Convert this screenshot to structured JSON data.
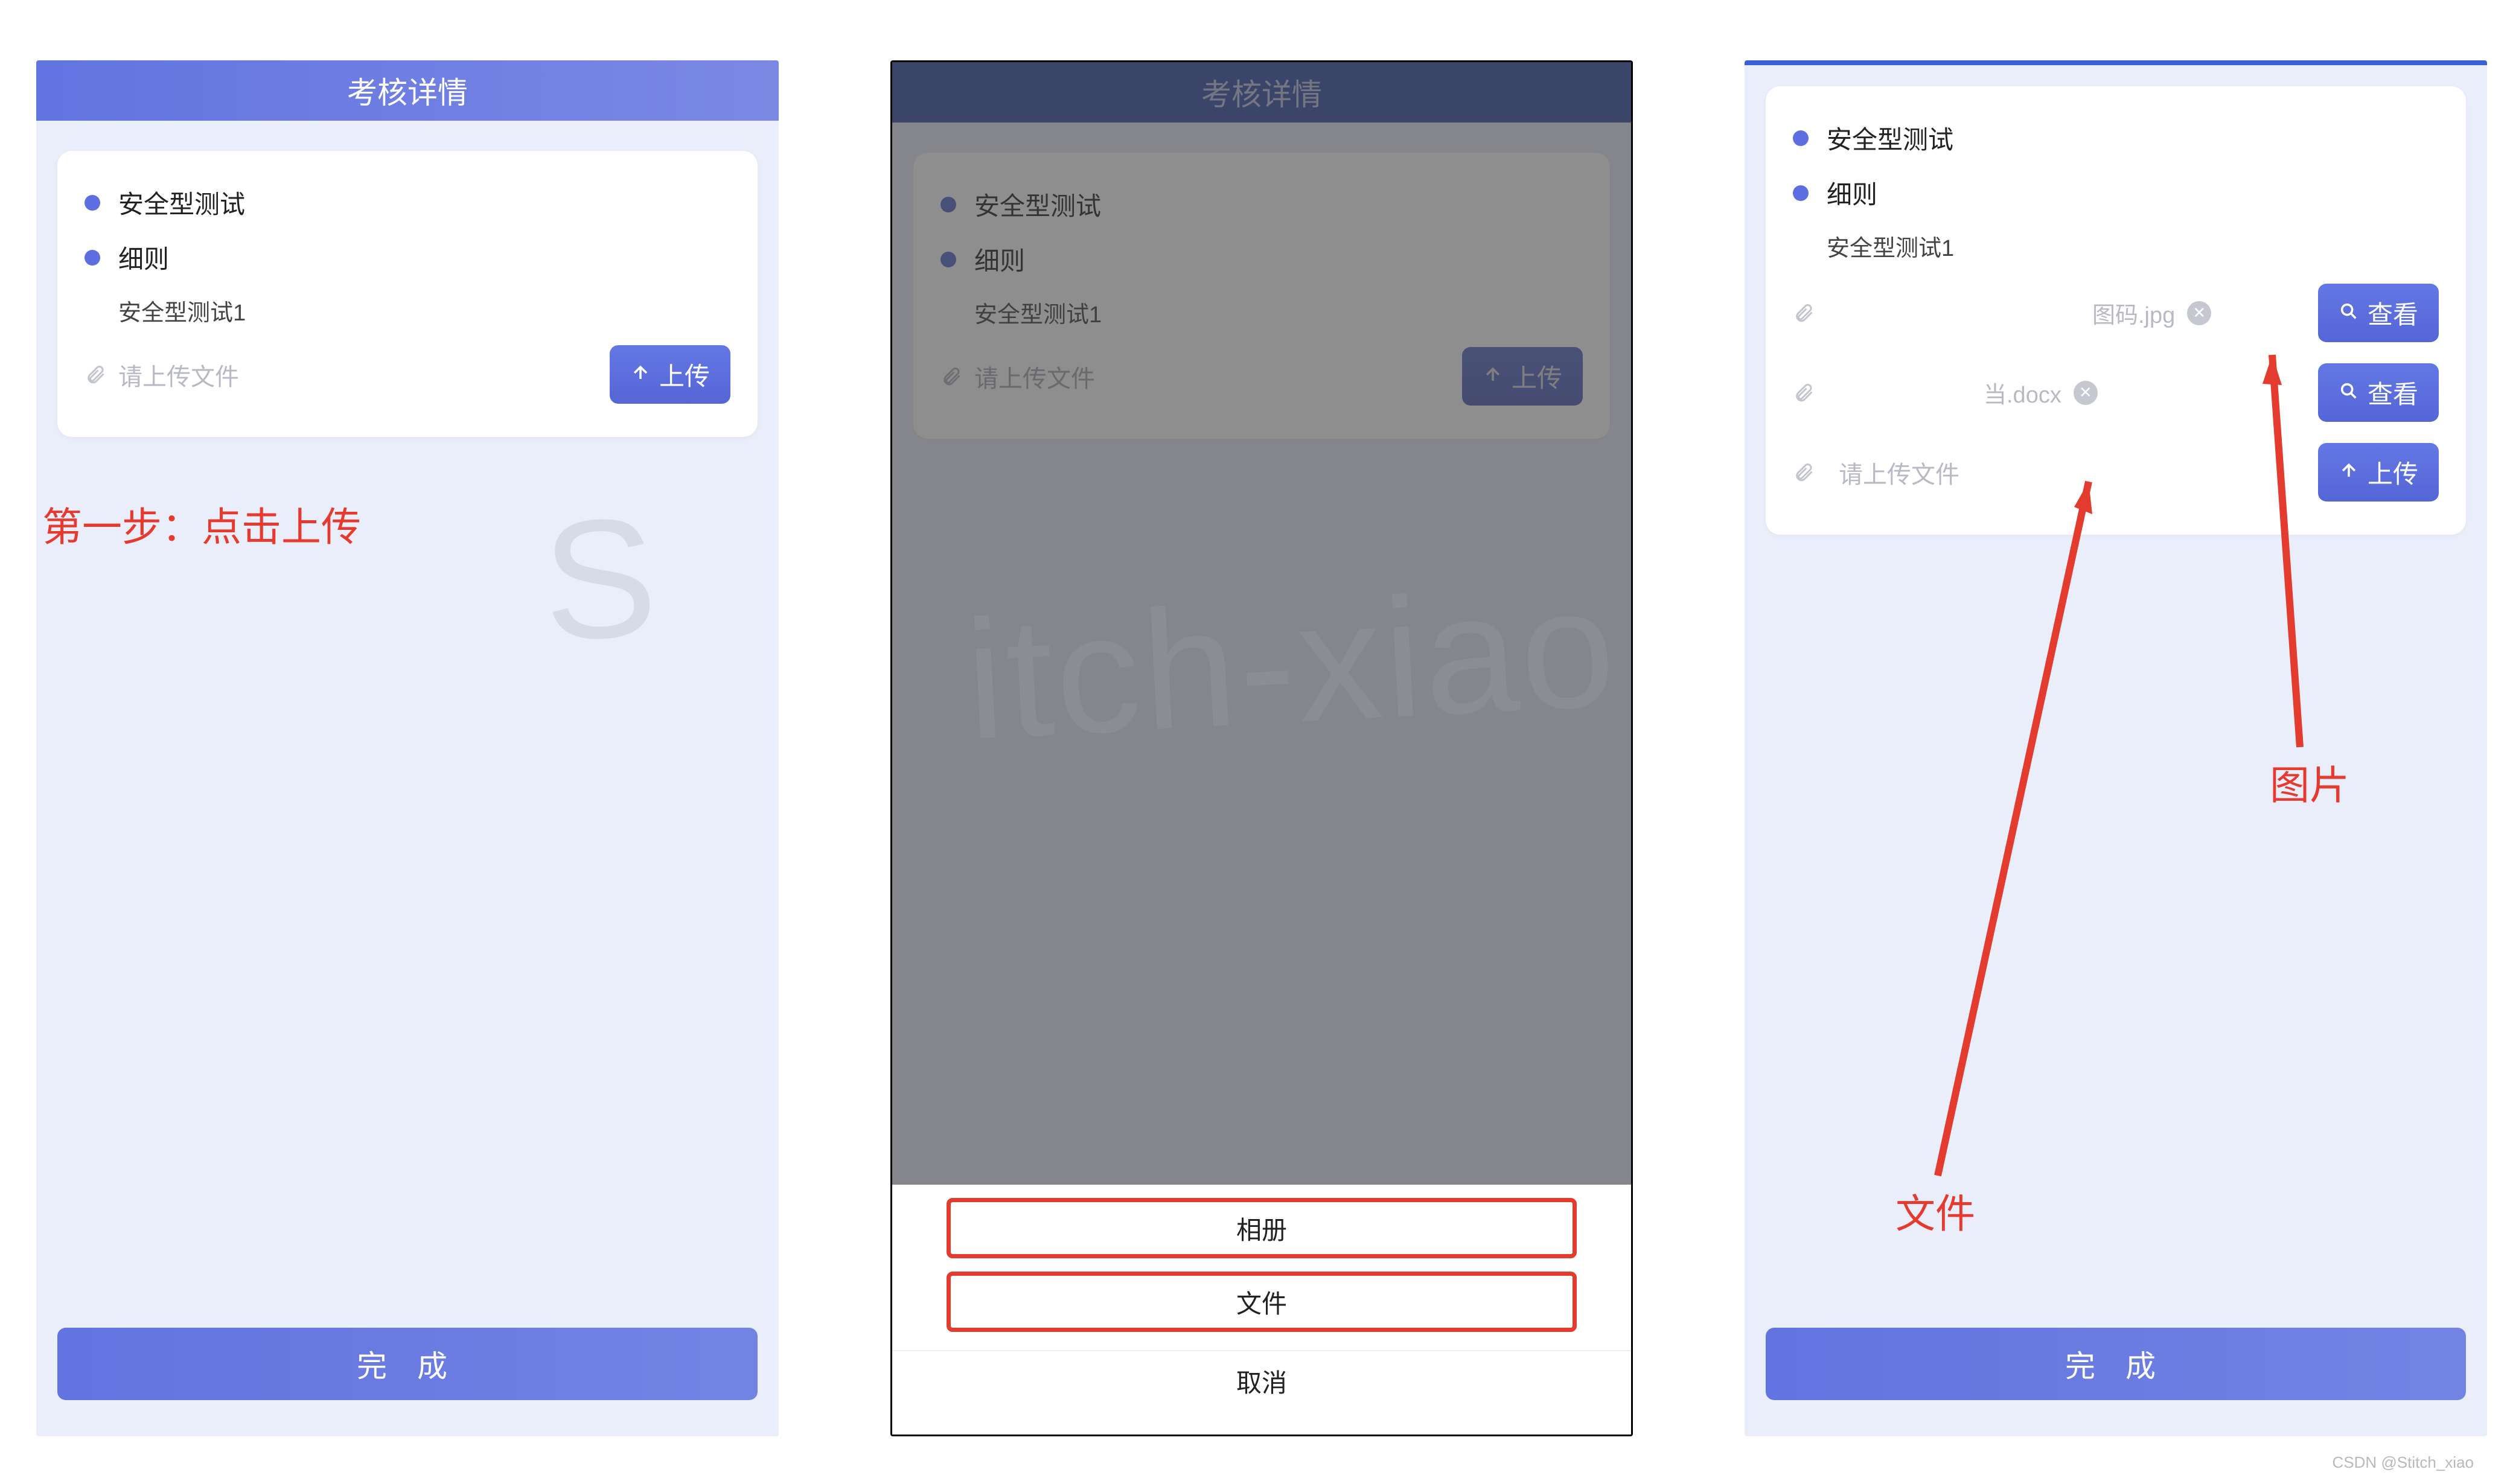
{
  "panel1": {
    "header": "考核详情",
    "bullet1": "安全型测试",
    "bullet2": "细则",
    "sub": "安全型测试1",
    "placeholder": "请上传文件",
    "upload_btn": "上传",
    "complete": "完 成",
    "annotation": "第一步：点击上传"
  },
  "panel2": {
    "header": "考核详情",
    "bullet1": "安全型测试",
    "bullet2": "细则",
    "sub": "安全型测试1",
    "placeholder": "请上传文件",
    "upload_btn": "上传",
    "sheet": {
      "album": "相册",
      "file": "文件",
      "cancel": "取消"
    }
  },
  "panel3": {
    "bullet1": "安全型测试",
    "bullet2": "细则",
    "sub": "安全型测试1",
    "file1": "图码.jpg",
    "file2": "当.docx",
    "placeholder": "请上传文件",
    "view_btn": "查看",
    "upload_btn": "上传",
    "complete": "完 成",
    "anno_image": "图片",
    "anno_file": "文件"
  },
  "watermark_left": "S",
  "watermark_right": "itch-xiao",
  "footer": "CSDN @Stitch_xiao"
}
